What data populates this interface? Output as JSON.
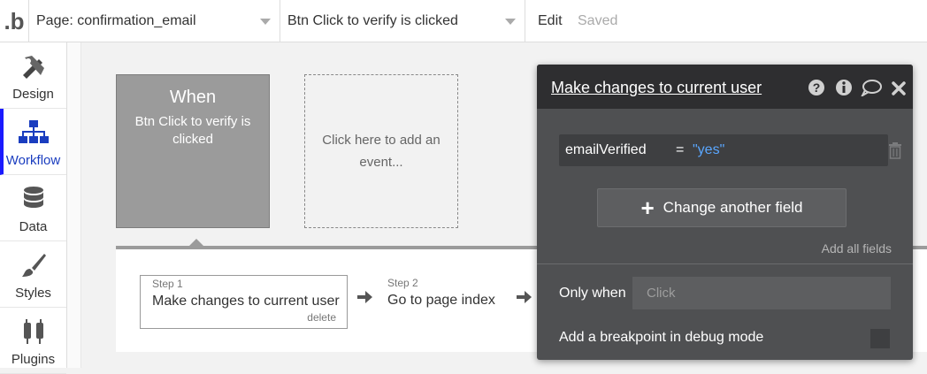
{
  "topbar": {
    "logo": ".b",
    "page_selector": "Page: confirmation_email",
    "workflow_selector": "Btn Click to verify is clicked",
    "edit_label": "Edit",
    "status": "Saved"
  },
  "leftnav": {
    "items": [
      {
        "label": "Design",
        "icon": "design-icon",
        "active": false
      },
      {
        "label": "Workflow",
        "icon": "workflow-icon",
        "active": true
      },
      {
        "label": "Data",
        "icon": "database-icon",
        "active": false
      },
      {
        "label": "Styles",
        "icon": "brush-icon",
        "active": false
      },
      {
        "label": "Plugins",
        "icon": "plug-icon",
        "active": false
      }
    ]
  },
  "event": {
    "title": "When",
    "name": "Btn Click to verify is clicked",
    "add_event_label": "Click here to add an event..."
  },
  "steps": [
    {
      "number": "Step 1",
      "name": "Make changes to current user",
      "delete_label": "delete"
    },
    {
      "number": "Step 2",
      "name": "Go to page index"
    }
  ],
  "editor": {
    "title": "Make changes to current user",
    "icons": [
      "help-icon",
      "info-icon",
      "comment-icon",
      "close-icon"
    ],
    "field": {
      "name": "emailVerified",
      "operator": "=",
      "value": "\"yes\""
    },
    "change_button": "Change another field",
    "add_all_label": "Add all fields",
    "only_when_label": "Only when",
    "only_when_placeholder": "Click",
    "breakpoint_label": "Add a breakpoint in debug mode"
  },
  "colors": {
    "accent": "#1a1aff",
    "value_blue": "#5aa7ff",
    "editor_bg": "#4f5052",
    "editor_header": "#2e2e30"
  }
}
